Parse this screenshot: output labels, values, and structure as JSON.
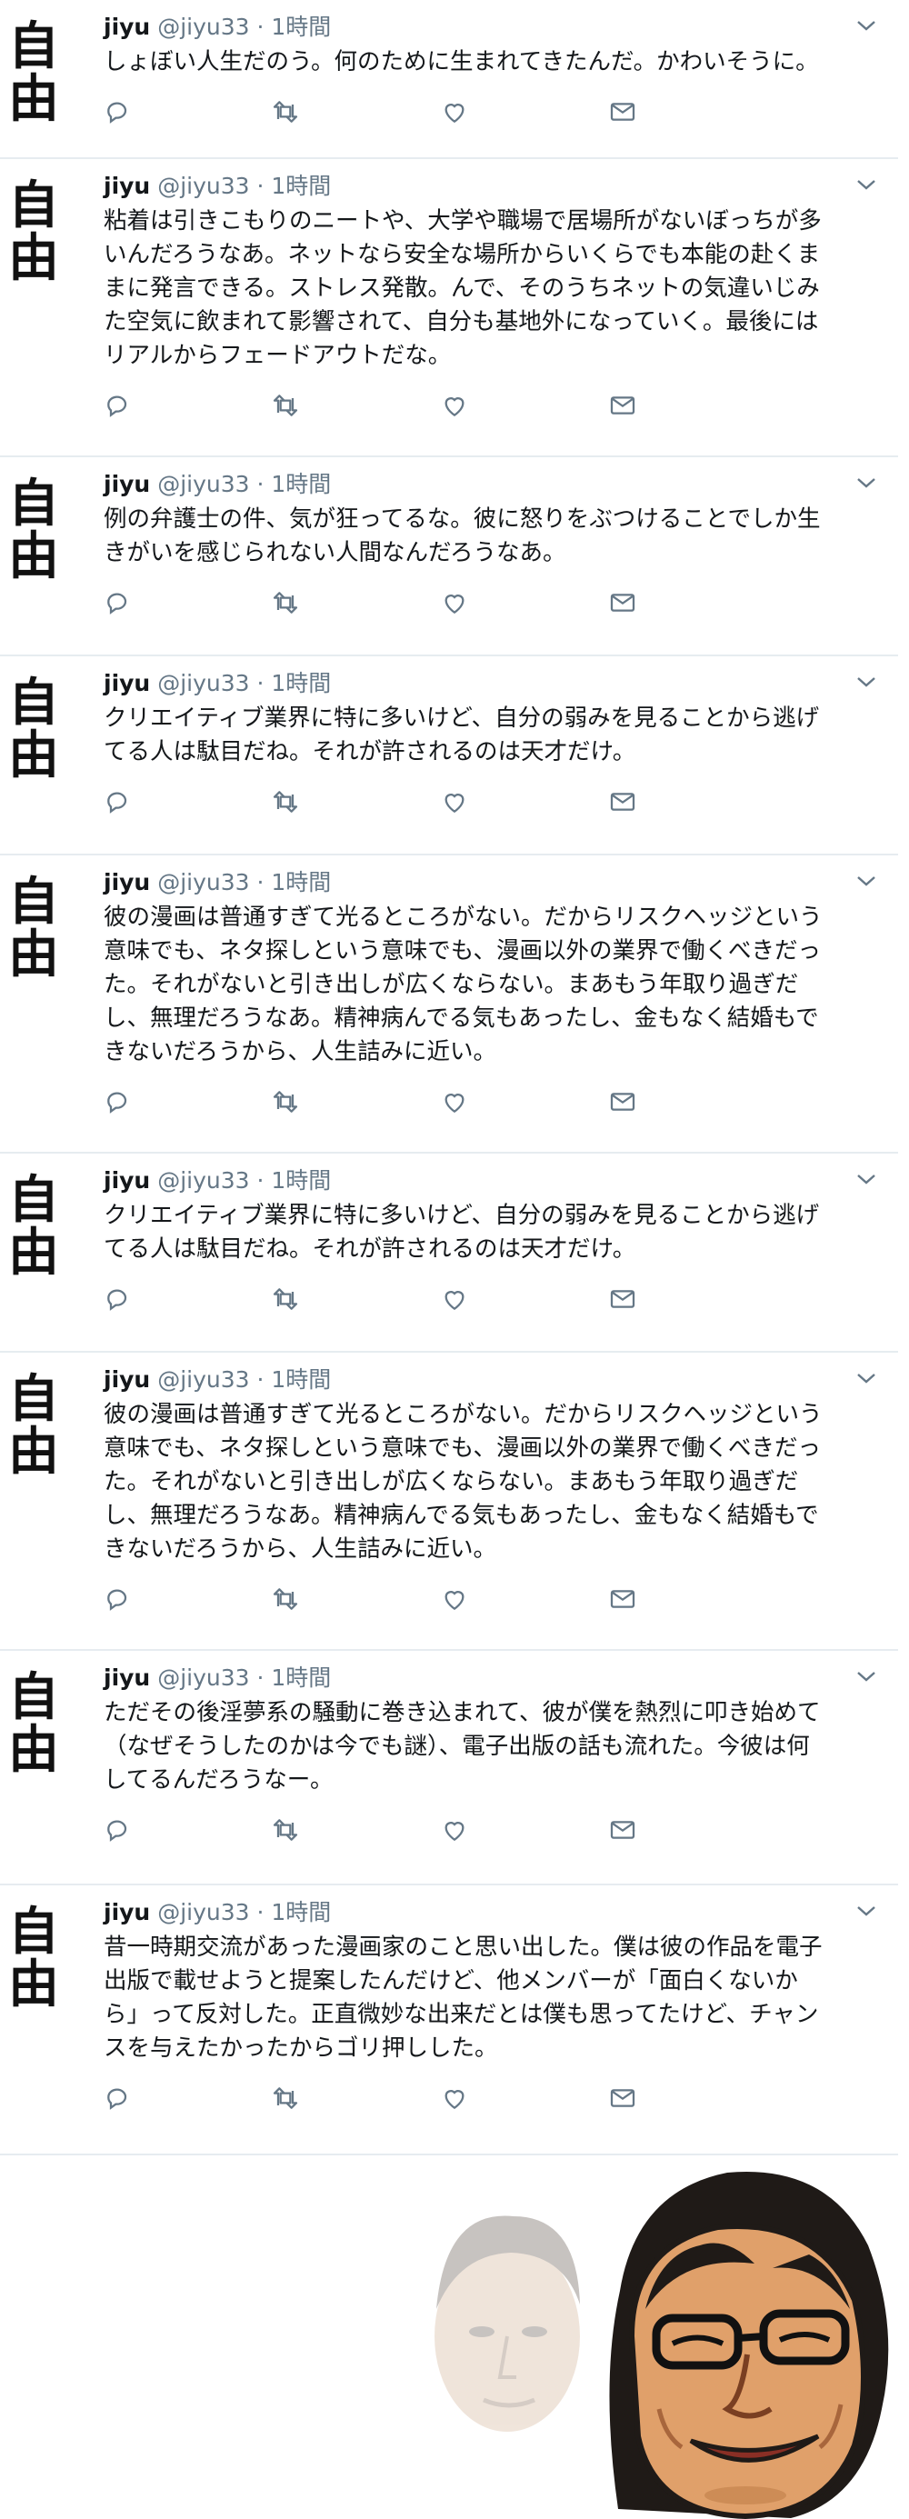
{
  "avatar_glyphs": [
    "自",
    "由"
  ],
  "tweets": [
    {
      "name": "jiyu",
      "handle": "@jiyu33",
      "separator": "·",
      "time": "1時間",
      "lines": [
        "しょぼい人生だのう。何のために生まれてきたんだ。かわいそうに。"
      ]
    },
    {
      "name": "jiyu",
      "handle": "@jiyu33",
      "separator": "·",
      "time": "1時間",
      "lines": [
        "粘着は引きこもりのニートや、大学や職場で居場所がないぼっちが多",
        "いんだろうなあ。ネットなら安全な場所からいくらでも本能の赴くま",
        "まに発言できる。ストレス発散。んで、そのうちネットの気違いじみ",
        "た空気に飲まれて影響されて、自分も基地外になっていく。最後には",
        "リアルからフェードアウトだな。"
      ]
    },
    {
      "name": "jiyu",
      "handle": "@jiyu33",
      "separator": "·",
      "time": "1時間",
      "lines": [
        "例の弁護士の件、気が狂ってるな。彼に怒りをぶつけることでしか生",
        "きがいを感じられない人間なんだろうなあ。"
      ]
    },
    {
      "name": "jiyu",
      "handle": "@jiyu33",
      "separator": "·",
      "time": "1時間",
      "lines": [
        "クリエイティブ業界に特に多いけど、自分の弱みを見ることから逃げ",
        "てる人は駄目だね。それが許されるのは天才だけ。"
      ]
    },
    {
      "name": "jiyu",
      "handle": "@jiyu33",
      "separator": "·",
      "time": "1時間",
      "lines": [
        "彼の漫画は普通すぎて光るところがない。だからリスクヘッジという",
        "意味でも、ネタ探しという意味でも、漫画以外の業界で働くべきだっ",
        "た。それがないと引き出しが広くならない。まあもう年取り過ぎだ",
        "し、無理だろうなあ。精神病んでる気もあったし、金もなく結婚もで",
        "きないだろうから、人生詰みに近い。"
      ]
    },
    {
      "name": "jiyu",
      "handle": "@jiyu33",
      "separator": "·",
      "time": "1時間",
      "lines": [
        "クリエイティブ業界に特に多いけど、自分の弱みを見ることから逃げ",
        "てる人は駄目だね。それが許されるのは天才だけ。"
      ]
    },
    {
      "name": "jiyu",
      "handle": "@jiyu33",
      "separator": "·",
      "time": "1時間",
      "lines": [
        "彼の漫画は普通すぎて光るところがない。だからリスクヘッジという",
        "意味でも、ネタ探しという意味でも、漫画以外の業界で働くべきだっ",
        "た。それがないと引き出しが広くならない。まあもう年取り過ぎだ",
        "し、無理だろうなあ。精神病んでる気もあったし、金もなく結婚もで",
        "きないだろうから、人生詰みに近い。"
      ]
    },
    {
      "name": "jiyu",
      "handle": "@jiyu33",
      "separator": "·",
      "time": "1時間",
      "lines": [
        "ただその後淫夢系の騒動に巻き込まれて、彼が僕を熱烈に叩き始めて",
        "（なぜそうしたのかは今でも謎）、電子出版の話も流れた。今彼は何",
        "してるんだろうなー。"
      ]
    },
    {
      "name": "jiyu",
      "handle": "@jiyu33",
      "separator": "·",
      "time": "1時間",
      "lines": [
        "昔一時期交流があった漫画家のこと思い出した。僕は彼の作品を電子",
        "出版で載せようと提案したんだけど、他メンバーが「面白くないか",
        "ら」って反対した。正直微妙な出来だとは僕も思ってたけど、チャン",
        "スを与えたかったからゴリ押しした。"
      ]
    }
  ],
  "colors": {
    "meta": "#657786",
    "text": "#14171a",
    "divider": "#e6ecf0"
  }
}
